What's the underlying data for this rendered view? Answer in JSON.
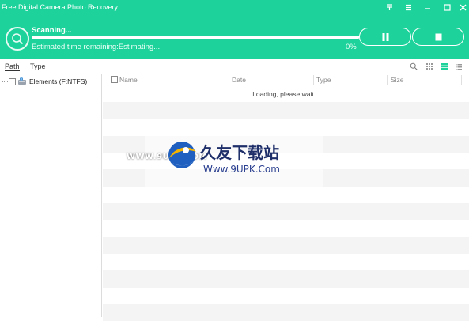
{
  "window": {
    "title": "Free Digital Camera Photo Recovery",
    "controls": {
      "pin": "pin-icon",
      "menu": "menu-icon",
      "minimize": "minimize-icon",
      "close": "close-icon"
    }
  },
  "scan": {
    "status": "Scanning...",
    "estimate": "Estimated time remaining:Estimating...",
    "percent": "0%",
    "progress": 0,
    "pause_icon": "pause-icon",
    "stop_icon": "stop-icon"
  },
  "toolbar": {
    "tabs": [
      {
        "label": "Path"
      },
      {
        "label": "Type"
      }
    ],
    "icons": [
      "search-icon",
      "thumbnail-view-icon",
      "grid-view-icon",
      "list-view-icon"
    ]
  },
  "tree": {
    "items": [
      {
        "label": "Elements (F:NTFS)"
      }
    ]
  },
  "list": {
    "columns": [
      "Name",
      "Date",
      "Type",
      "Size"
    ],
    "loading": "Loading, please wait..."
  },
  "watermark": {
    "url_left": "WWW.9UPK.COM",
    "brand": "久友下载站",
    "url": "Www.9UPK.Com"
  },
  "colors": {
    "accent": "#1ed39b"
  }
}
